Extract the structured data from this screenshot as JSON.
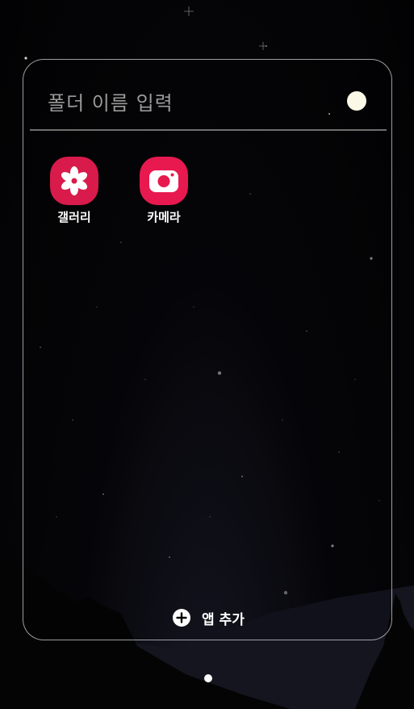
{
  "folder": {
    "name_placeholder": "폴더 이름 입력",
    "color": "#fbf8e8"
  },
  "apps": [
    {
      "label": "갤러리",
      "icon": "gallery-flower-icon",
      "color": "#d81b4a"
    },
    {
      "label": "카메라",
      "icon": "camera-icon",
      "color": "#e8194f"
    }
  ],
  "add_apps": {
    "label": "앱 추가",
    "icon": "plus-circle-icon"
  },
  "page_indicator": {
    "current_page": 1,
    "total_pages": 1
  }
}
